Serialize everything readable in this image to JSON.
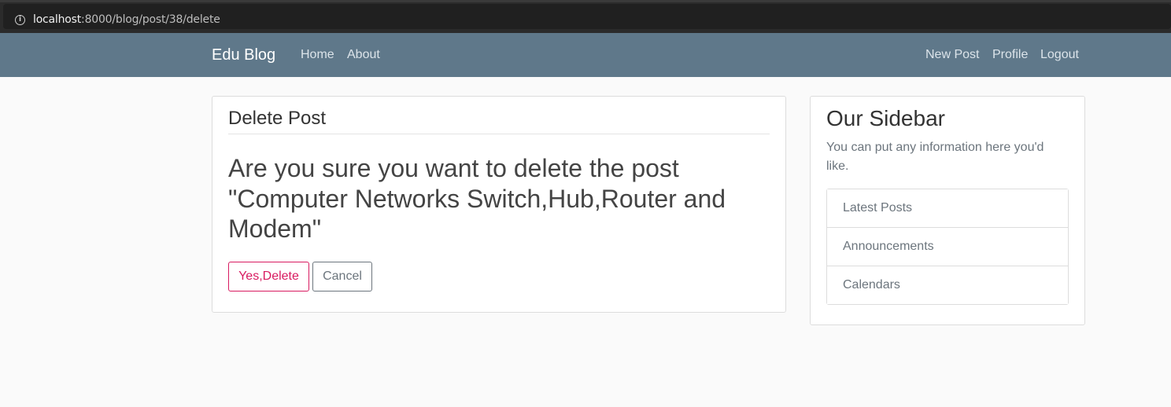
{
  "browser": {
    "url_host": "localhost",
    "url_rest": ":8000/blog/post/38/delete",
    "info_icon": "info-icon"
  },
  "navbar": {
    "brand": "Edu Blog",
    "left_links": [
      "Home",
      "About"
    ],
    "right_links": [
      "New Post",
      "Profile",
      "Logout"
    ],
    "background": "#5f788a"
  },
  "delete_card": {
    "title": "Delete Post",
    "question": "Are you sure you want to delete the post \"Computer Networks Switch,Hub,Router and Modem\"",
    "confirm_label": "Yes,Delete",
    "cancel_label": "Cancel",
    "danger_color": "#d81b60"
  },
  "sidebar": {
    "title": "Our Sidebar",
    "description": "You can put any information here you'd like.",
    "items": [
      "Latest Posts",
      "Announcements",
      "Calendars"
    ]
  }
}
